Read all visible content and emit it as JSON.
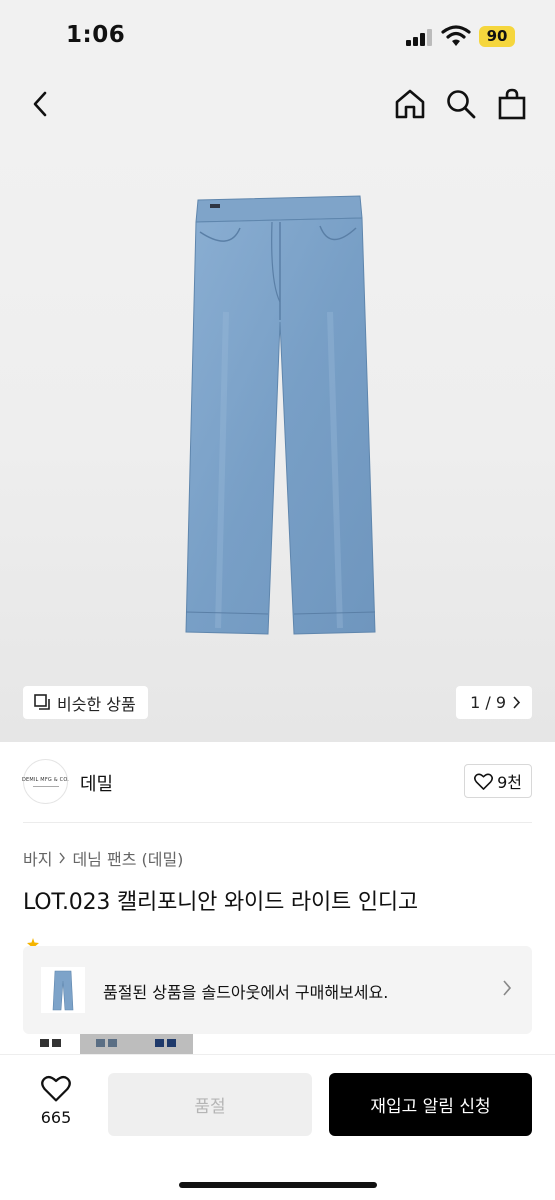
{
  "status": {
    "time": "1:06",
    "battery": "90"
  },
  "header": {
    "back_icon": "chevron-left-icon",
    "home_icon": "home-icon",
    "search_icon": "search-icon",
    "bag_icon": "shopping-bag-icon"
  },
  "hero": {
    "similar_label": "비슷한 상품",
    "page_indicator": "1 / 9",
    "jeans_color": "#7da3c9"
  },
  "brand": {
    "logo_text": "DEMIL MFG & CO.",
    "name": "데밀",
    "likes": "9천"
  },
  "breadcrumb": {
    "category": "바지",
    "subcategory": "데님 팬츠 (데밀)"
  },
  "product": {
    "title": "LOT.023 캘리포니안 와이드 라이트 인디고"
  },
  "soldout_banner": {
    "text": "품절된 상품을 솔드아웃에서 구매해보세요."
  },
  "bottom": {
    "wish_count": "665",
    "soldout_label": "품절",
    "restock_label": "재입고 알림 신청"
  },
  "colors": {
    "accent": "#000000",
    "battery": "#f5d63d",
    "disabled_bg": "#efefef"
  }
}
